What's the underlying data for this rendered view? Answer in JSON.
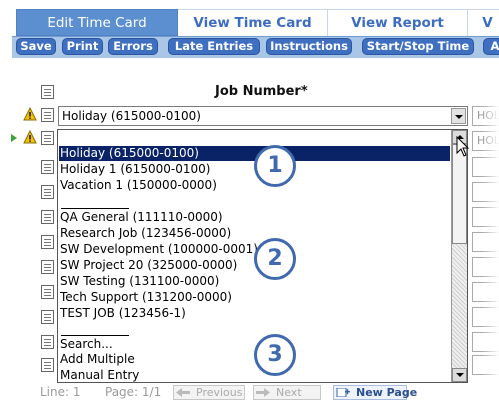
{
  "tabs": [
    {
      "label": "Edit Time Card",
      "active": true
    },
    {
      "label": "View Time Card",
      "active": false
    },
    {
      "label": "View Report",
      "active": false
    },
    {
      "label": "V",
      "active": false
    }
  ],
  "toolbar": {
    "buttons": [
      "Save",
      "Print",
      "Errors",
      "Late Entries",
      "Instructions",
      "Start/Stop Time",
      "A"
    ]
  },
  "grid": {
    "job_number_header": "Job Number*",
    "row1_value": "Holiday (615000-0100)",
    "right_field_text": "HOL"
  },
  "dropdown": {
    "options": [
      "Holiday (615000-0100)",
      "Holiday 1 (615000-0100)",
      "Vacation 1 (150000-0000)",
      "QA General (111110-0000)",
      "Research Job (123456-0000)",
      "SW Development (100000-0001)",
      "SW Project 20 (325000-0000)",
      "SW Testing (131100-0000)",
      "Tech Support (131200-0000)",
      "TEST JOB (123456-1)",
      "Search...",
      "Add Multiple",
      "Manual Entry"
    ],
    "selected": "Holiday (615000-0100)"
  },
  "callouts": [
    "1",
    "2",
    "3"
  ],
  "footer": {
    "line": "Line: 1",
    "page": "Page: 1/1",
    "previous": "Previous",
    "next": "Next",
    "new_page": "New Page"
  },
  "colors": {
    "accent": "#3f6fc0",
    "toolbar_bg": "#a9c6e7",
    "selected_option": "#0a2367",
    "callout": "#4169ad"
  }
}
